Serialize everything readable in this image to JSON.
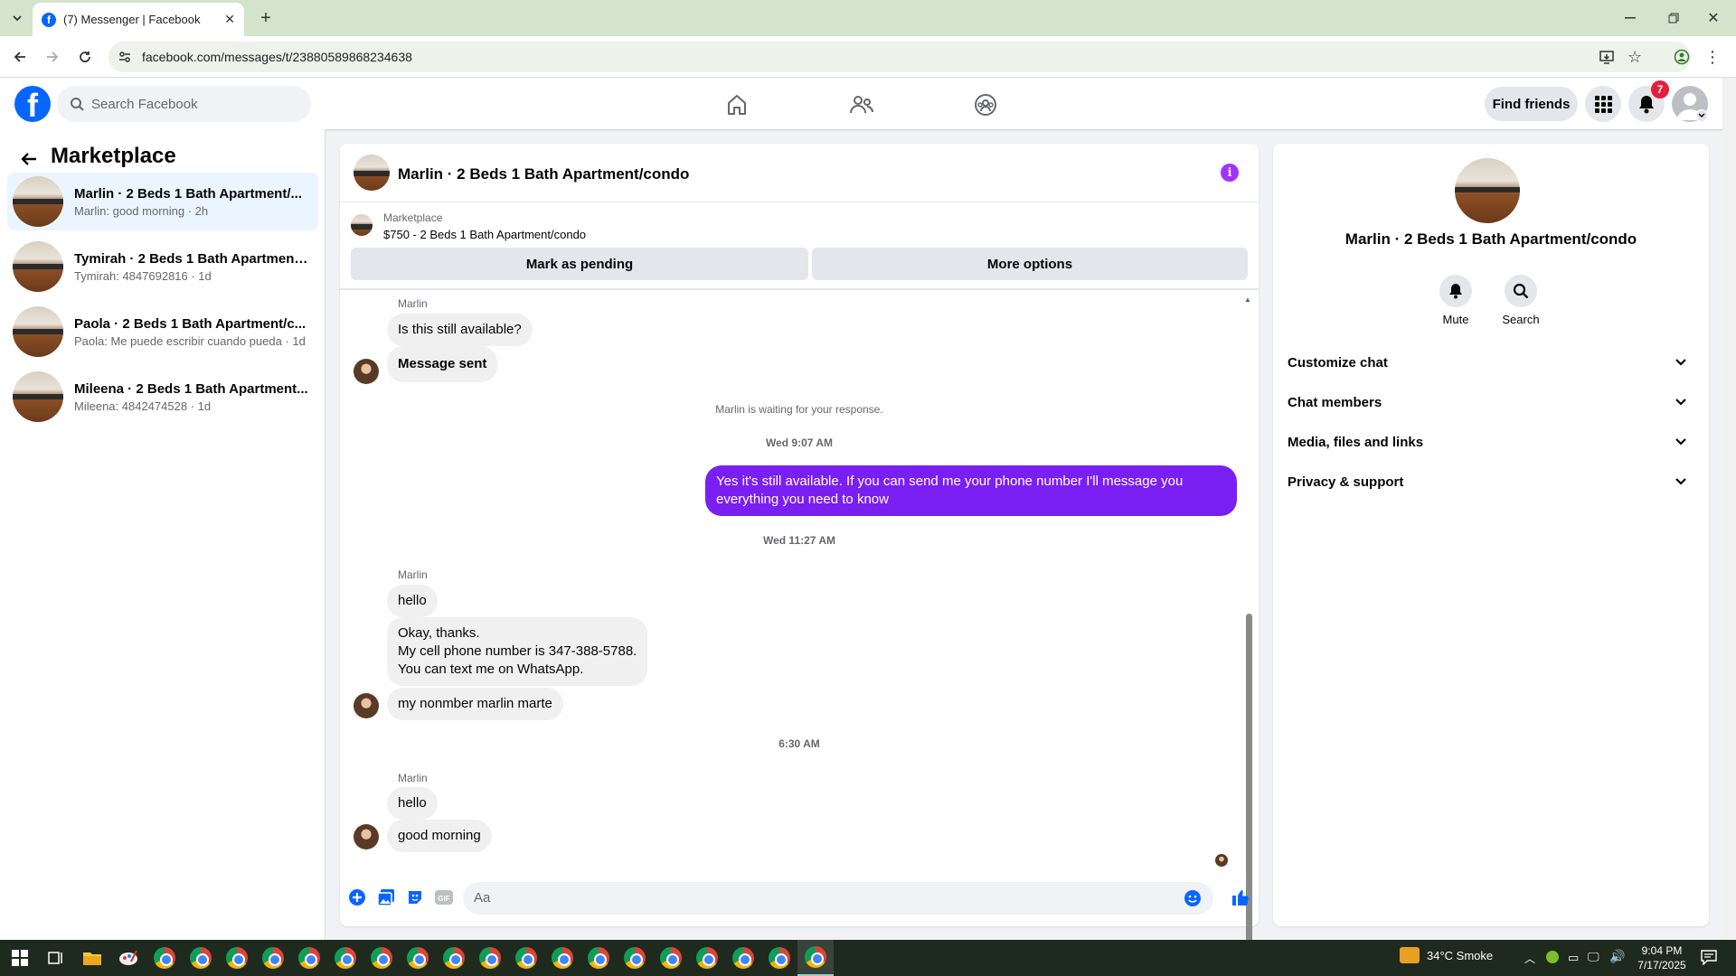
{
  "browser": {
    "tab_title": "(7) Messenger | Facebook",
    "url": "facebook.com/messages/t/23880589868234638"
  },
  "header": {
    "search_placeholder": "Search Facebook",
    "find_friends_label": "Find friends",
    "notification_count": "7"
  },
  "left": {
    "title": "Marketplace",
    "conversations": [
      {
        "title": "Marlin · 2 Beds 1 Bath Apartment/...",
        "subtitle": "Marlin: good morning · 2h"
      },
      {
        "title": "Tymirah · 2 Beds 1 Bath Apartment...",
        "subtitle": "Tymirah: 4847692816 · 1d"
      },
      {
        "title": "Paola · 2 Beds 1 Bath Apartment/c...",
        "subtitle": "Paola: Me puede escribir cuando pueda · 1d"
      },
      {
        "title": "Mileena · 2 Beds 1 Bath Apartment...",
        "subtitle": "Mileena: 4842474528 · 1d"
      }
    ]
  },
  "chat": {
    "title": "Marlin · 2 Beds 1 Bath Apartment/condo",
    "listing_source": "Marketplace",
    "listing_desc": "$750 - 2 Beds 1 Bath Apartment/condo",
    "mark_pending_label": "Mark as pending",
    "more_options_label": "More options",
    "sender_name": "Marlin",
    "messages": {
      "m1": "Is this still available?",
      "m2": "Message sent",
      "waiting": "Marlin is waiting for your response.",
      "ts1": "Wed 9:07 AM",
      "reply": "Yes it's still available. If you can send me your phone number I'll message you everything you need to know",
      "ts2": "Wed 11:27 AM",
      "m3": "hello",
      "m4_line1": "Okay, thanks.",
      "m4_line2": "My cell phone number is 347-388-5788.",
      "m4_line3": "You can text me on WhatsApp.",
      "m5": "my nonmber marlin marte",
      "ts3": "6:30 AM",
      "m6": "hello",
      "m7": "good morning"
    },
    "composer_placeholder": "Aa",
    "accent_color": "#7a1ff2"
  },
  "right": {
    "name": "Marlin · 2 Beds 1 Bath Apartment/condo",
    "mute_label": "Mute",
    "search_label": "Search",
    "sections": [
      "Customize chat",
      "Chat members",
      "Media, files and links",
      "Privacy & support"
    ]
  },
  "taskbar": {
    "weather": "34°C Smoke",
    "time": "9:04 PM",
    "date": "7/17/2025"
  }
}
